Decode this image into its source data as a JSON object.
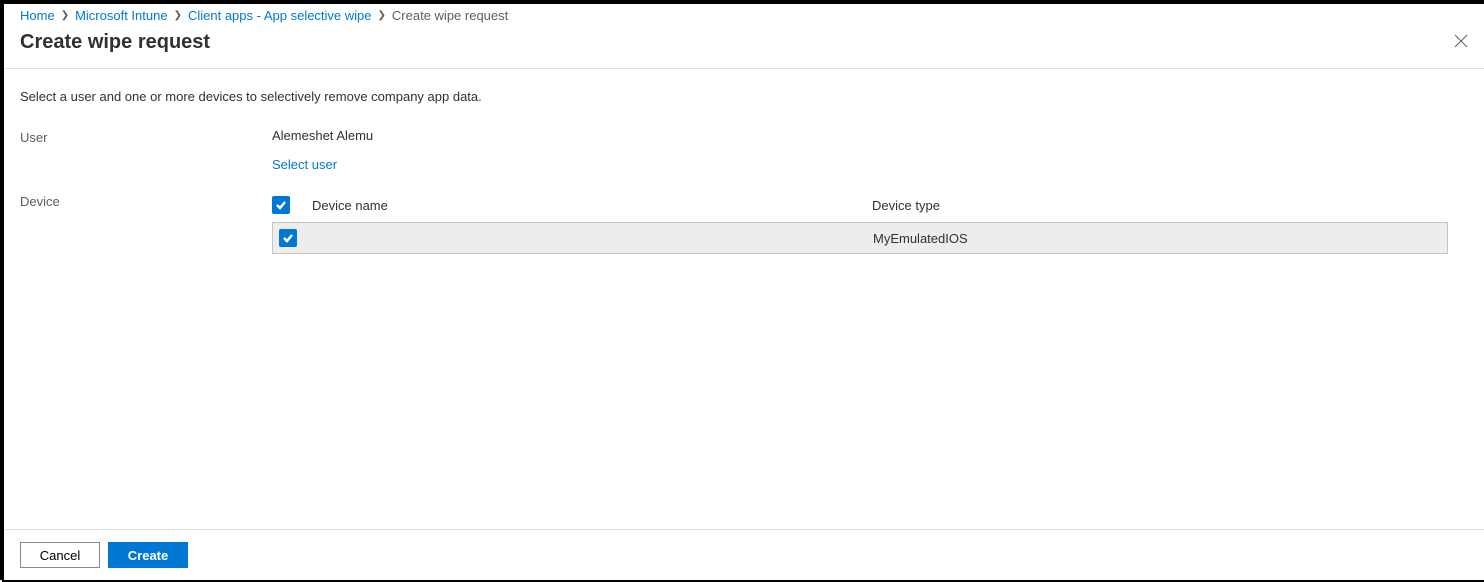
{
  "breadcrumb": {
    "items": [
      {
        "label": "Home",
        "link": true
      },
      {
        "label": "Microsoft Intune",
        "link": true
      },
      {
        "label": "Client apps - App selective wipe",
        "link": true
      },
      {
        "label": "Create wipe request",
        "link": false
      }
    ]
  },
  "page_title": "Create wipe request",
  "instruction": "Select a user and one or more devices to selectively remove company app data.",
  "labels": {
    "user": "User",
    "device": "Device"
  },
  "user": {
    "name": "Alemeshet Alemu",
    "select_link": "Select user"
  },
  "device_table": {
    "columns": {
      "name": "Device name",
      "type": "Device type"
    },
    "rows": [
      {
        "name": "",
        "type": "MyEmulatedIOS",
        "checked": true
      }
    ],
    "select_all_checked": true
  },
  "footer": {
    "cancel": "Cancel",
    "create": "Create"
  }
}
